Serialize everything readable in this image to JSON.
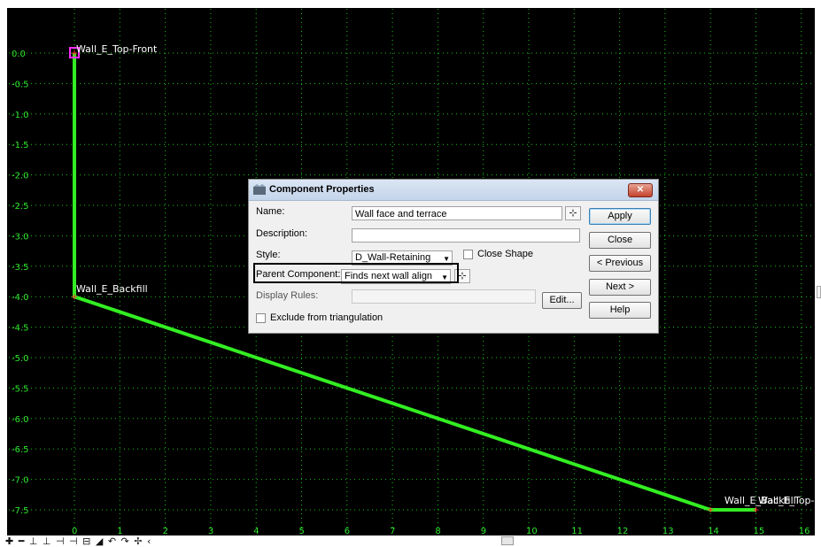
{
  "viewer": {
    "background": "#000000",
    "grid_color": "#19c619",
    "line_color": "#33ee22",
    "point_marker_color": "#ff2bff",
    "x_axis_labels": [
      "0",
      "1",
      "2",
      "3",
      "4",
      "5",
      "6",
      "7",
      "8",
      "9",
      "10",
      "11",
      "12",
      "13",
      "14",
      "15",
      "16"
    ],
    "y_axis_labels": [
      "0.0",
      "-0.5",
      "-1.0",
      "-1.5",
      "-2.0",
      "-2.5",
      "-3.0",
      "-3.5",
      "-4.0",
      "-4.5",
      "-5.0",
      "-5.5",
      "-6.0",
      "-6.5",
      "-7.0",
      "-7.5"
    ],
    "point_labels": {
      "top_front": "Wall_E_Top-Front",
      "backfill": "Wall_E_Backfill",
      "right_overlap": "Wall_E_Top-Back"
    },
    "polyline_points": [
      {
        "x": 0,
        "y": 0.0
      },
      {
        "x": 0,
        "y": -4.0
      },
      {
        "x": 14,
        "y": -7.5
      },
      {
        "x": 15,
        "y": -7.5
      }
    ]
  },
  "dialog": {
    "title": "Component Properties",
    "close_glyph": "✕",
    "name_label": "Name:",
    "name_value": "Wall face and terrace",
    "description_label": "Description:",
    "description_value": "",
    "style_label": "Style:",
    "style_value": "D_Wall-Retaining",
    "close_shape_label": "Close Shape",
    "parent_component_label": "Parent Component:",
    "parent_component_value": "Finds next wall align",
    "display_rules_label": "Display Rules:",
    "display_rules_value": "",
    "edit_button": "Edit...",
    "exclude_label": "Exclude from triangulation",
    "buttons": {
      "apply": "Apply",
      "close": "Close",
      "previous": "< Previous",
      "next": "Next >",
      "help": "Help"
    }
  },
  "toolbar": {
    "icons": "✚ ━ ⊥ ⊥ ⊣ ⊣ ⊟ ◢ ↶ ↷ ✢ ‹"
  }
}
